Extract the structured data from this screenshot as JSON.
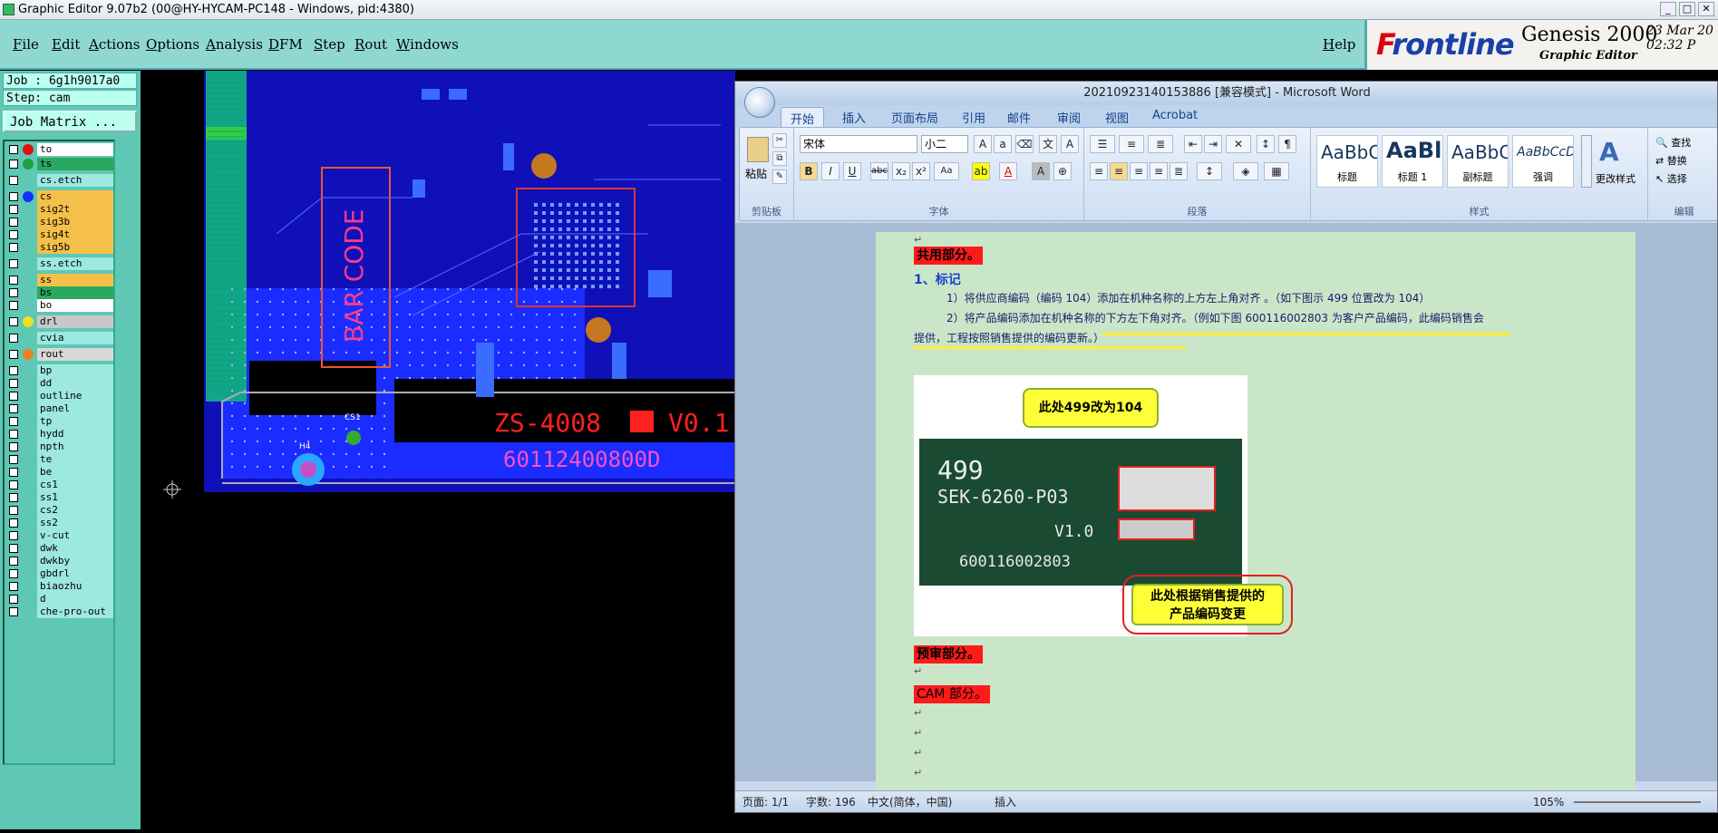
{
  "genesis": {
    "title": "Graphic Editor 9.07b2 (00@HY-HYCAM-PC148 - Windows, pid:4380)",
    "menus": [
      "File",
      "Edit",
      "Actions",
      "Options",
      "Analysis",
      "DFM",
      "Step",
      "Rout",
      "Windows"
    ],
    "help": "Help",
    "logo": {
      "brand_F": "F",
      "brand_rest": "rontline",
      "product": "Genesis 2000",
      "subtitle": "Graphic Editor",
      "date": "23 Mar 20",
      "time": "02:32 P"
    },
    "job": "Job : 6g1h9017a0",
    "step": "Step: cam",
    "job_matrix": "Job Matrix ...",
    "layers": [
      {
        "name": "to",
        "dot": "#e01010",
        "bg": "#ffffff"
      },
      {
        "name": "ts",
        "dot": "#20a040",
        "bg": "#2aa860"
      },
      {
        "name": "cs.etch",
        "dot": "",
        "bg": "#9de8e0"
      },
      {
        "name": "cs",
        "dot": "#1030ff",
        "bg": "#f5c04a"
      },
      {
        "name": "sig2t",
        "dot": "",
        "bg": "#f5c04a"
      },
      {
        "name": "sig3b",
        "dot": "",
        "bg": "#f5c04a"
      },
      {
        "name": "sig4t",
        "dot": "",
        "bg": "#f5c04a"
      },
      {
        "name": "sig5b",
        "dot": "",
        "bg": "#f5c04a"
      },
      {
        "name": "ss.etch",
        "dot": "",
        "bg": "#9de8e0"
      },
      {
        "name": "ss",
        "dot": "",
        "bg": "#f5c04a"
      },
      {
        "name": "bs",
        "dot": "",
        "bg": "#2aa860"
      },
      {
        "name": "bo",
        "dot": "",
        "bg": "#ffffff"
      },
      {
        "name": "drl",
        "dot": "#f0e020",
        "bg": "#c8c8c8"
      },
      {
        "name": "cvia",
        "dot": "",
        "bg": "#9de8e0"
      },
      {
        "name": "rout",
        "dot": "#f08020",
        "bg": "#d8d8d8"
      },
      {
        "name": "bp",
        "dot": "",
        "bg": "#9de8e0"
      },
      {
        "name": "dd",
        "dot": "",
        "bg": "#9de8e0"
      },
      {
        "name": "outline",
        "dot": "",
        "bg": "#9de8e0"
      },
      {
        "name": "panel",
        "dot": "",
        "bg": "#9de8e0"
      },
      {
        "name": "tp",
        "dot": "",
        "bg": "#9de8e0"
      },
      {
        "name": "hydd",
        "dot": "",
        "bg": "#9de8e0"
      },
      {
        "name": "npth",
        "dot": "",
        "bg": "#9de8e0"
      },
      {
        "name": "te",
        "dot": "",
        "bg": "#9de8e0"
      },
      {
        "name": "be",
        "dot": "",
        "bg": "#9de8e0"
      },
      {
        "name": "cs1",
        "dot": "",
        "bg": "#9de8e0"
      },
      {
        "name": "ss1",
        "dot": "",
        "bg": "#9de8e0"
      },
      {
        "name": "cs2",
        "dot": "",
        "bg": "#9de8e0"
      },
      {
        "name": "ss2",
        "dot": "",
        "bg": "#9de8e0"
      },
      {
        "name": "v-cut",
        "dot": "",
        "bg": "#9de8e0"
      },
      {
        "name": "dwk",
        "dot": "",
        "bg": "#9de8e0"
      },
      {
        "name": "dwkby",
        "dot": "",
        "bg": "#9de8e0"
      },
      {
        "name": "gbdrl",
        "dot": "",
        "bg": "#9de8e0"
      },
      {
        "name": "biaozhu",
        "dot": "",
        "bg": "#9de8e0"
      },
      {
        "name": "d",
        "dot": "",
        "bg": "#9de8e0"
      },
      {
        "name": "che-pro-out",
        "dot": "",
        "bg": "#9de8e0"
      }
    ],
    "pcb": {
      "bar_code": "BAR CODE",
      "model": "ZS-4008",
      "version": "V0.1",
      "serial": "60112400800D",
      "mark_h4": "H4",
      "mark_cs1": "CS1"
    }
  },
  "word": {
    "title": "20210923140153886 [兼容模式] - Microsoft Word",
    "tabs": [
      "开始",
      "插入",
      "页面布局",
      "引用",
      "邮件",
      "审阅",
      "视图",
      "Acrobat"
    ],
    "font_name": "宋体",
    "font_size": "小二",
    "paste_label": "粘贴",
    "group_labels": [
      "剪贴板",
      "字体",
      "段落",
      "样式",
      "编辑"
    ],
    "styles": [
      {
        "sample": "AaBbC",
        "label": "标题"
      },
      {
        "sample": "AaBl",
        "label": "标题 1"
      },
      {
        "sample": "AaBbC",
        "label": "副标题"
      },
      {
        "sample": "AaBbCcDd",
        "label": "强调"
      }
    ],
    "change_styles": "更改样式",
    "edit_items": [
      "查找",
      "替换",
      "选择"
    ],
    "doc": {
      "h1": "共用部分。",
      "sub1": "1、标记",
      "p1": "1）将供应商编码（编码 104）添加在机种名称的上方左上角对齐 。（如下图示 499 位置改为 104）",
      "p2a": "2）将产品编码添加在机种名称的下方左下角对齐。（例如下图 600116002803 为客户产品编码，此编码销售会",
      "p2b": "提供，工程按照销售提供的编码更新。）",
      "callout1": "此处499改为104",
      "callout2a": "此处根据销售提供的",
      "callout2b": "产品编码变更",
      "board_code": "499",
      "board_model": "SEK-6260-P03",
      "board_ver": "V1.0",
      "board_serial": "600116002803",
      "h2": "预审部分。",
      "h3": "CAM 部分。"
    },
    "status": {
      "page": "页面: 1/1",
      "words": "字数: 196",
      "lang": "中文(简体，中国)",
      "mode": "插入",
      "zoom": "105%"
    }
  }
}
